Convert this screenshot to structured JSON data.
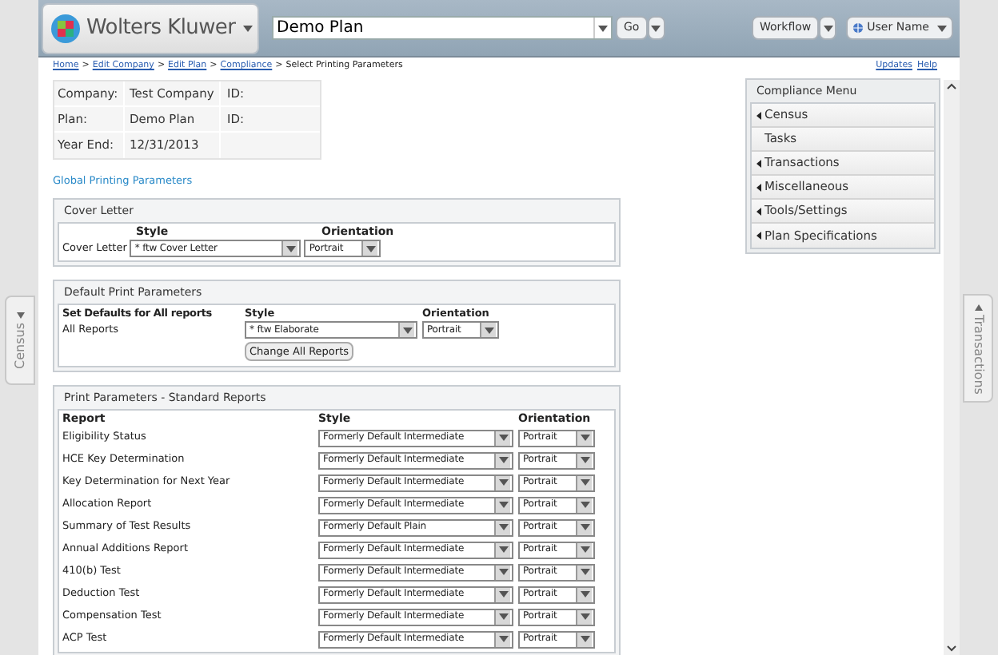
{
  "header": {
    "logo": "Wolters Kluwer",
    "search_value": "Demo Plan",
    "go_button": "Go",
    "workflow_button": "Workflow",
    "user_button": "User Name"
  },
  "breadcrumb": [
    {
      "kind": "link",
      "label": "Home"
    },
    {
      "kind": "separator",
      "label": ">"
    },
    {
      "kind": "link",
      "label": "Edit Company"
    },
    {
      "kind": "separator",
      "label": ">"
    },
    {
      "kind": "link",
      "label": "Edit Plan"
    },
    {
      "kind": "separator",
      "label": ">"
    },
    {
      "kind": "link",
      "label": "Compliance"
    },
    {
      "kind": "separator",
      "label": ">"
    },
    {
      "kind": "current",
      "label": "Select Printing Parameters"
    }
  ],
  "top_links": [
    "Updates",
    "Help"
  ],
  "plan_info": [
    {
      "label": "Company:",
      "value": "Test Company",
      "id_label": "ID:"
    },
    {
      "label": "Plan:",
      "value": "Demo Plan",
      "id_label": "ID:"
    },
    {
      "label": "Year End:",
      "value": "12/31/2013"
    }
  ],
  "global_link": "Global Printing Parameters",
  "cover_letter": {
    "title": "Cover Letter",
    "style_heading": "Style",
    "orientation_heading": "Orientation",
    "row_label": "Cover Letter",
    "style": "* ftw Cover Letter",
    "orientation": "Portrait"
  },
  "defaults": {
    "title": "Default Print Parameters",
    "heading": "Set Defaults for All reports",
    "style_heading": "Style",
    "orientation_heading": "Orientation",
    "row_label": "All Reports",
    "style": "* ftw Elaborate",
    "orientation": "Portrait",
    "button": "Change All Reports"
  },
  "standard": {
    "title": "Print Parameters - Standard Reports",
    "columns": [
      "Report",
      "Style",
      "Orientation"
    ],
    "rows": [
      {
        "report": "Eligibility Status",
        "style": "Formerly Default Intermediate",
        "orientation": "Portrait"
      },
      {
        "report": "HCE Key Determination",
        "style": "Formerly Default Intermediate",
        "orientation": "Portrait"
      },
      {
        "report": "Key Determination for Next Year",
        "style": "Formerly Default Intermediate",
        "orientation": "Portrait"
      },
      {
        "report": "Allocation Report",
        "style": "Formerly Default Intermediate",
        "orientation": "Portrait"
      },
      {
        "report": "Summary of Test Results",
        "style": "Formerly Default Plain",
        "orientation": "Portrait"
      },
      {
        "report": "Annual Additions Report",
        "style": "Formerly Default Intermediate",
        "orientation": "Portrait"
      },
      {
        "report": "410(b) Test",
        "style": "Formerly Default Intermediate",
        "orientation": "Portrait"
      },
      {
        "report": "Deduction Test",
        "style": "Formerly Default Intermediate",
        "orientation": "Portrait"
      },
      {
        "report": "Compensation Test",
        "style": "Formerly Default Intermediate",
        "orientation": "Portrait"
      },
      {
        "report": "ACP Test",
        "style": "Formerly Default Intermediate",
        "orientation": "Portrait"
      }
    ]
  },
  "compliance_menu": {
    "title": "Compliance Menu",
    "items": [
      {
        "label": "Census",
        "expandable": true
      },
      {
        "label": "Tasks",
        "expandable": false
      },
      {
        "label": "Transactions",
        "expandable": true
      },
      {
        "label": "Miscellaneous",
        "expandable": true
      },
      {
        "label": "Tools/Settings",
        "expandable": true
      },
      {
        "label": "Plan Specifications",
        "expandable": true
      }
    ]
  },
  "side_tabs": {
    "left": "Census",
    "right": "Transactions"
  }
}
